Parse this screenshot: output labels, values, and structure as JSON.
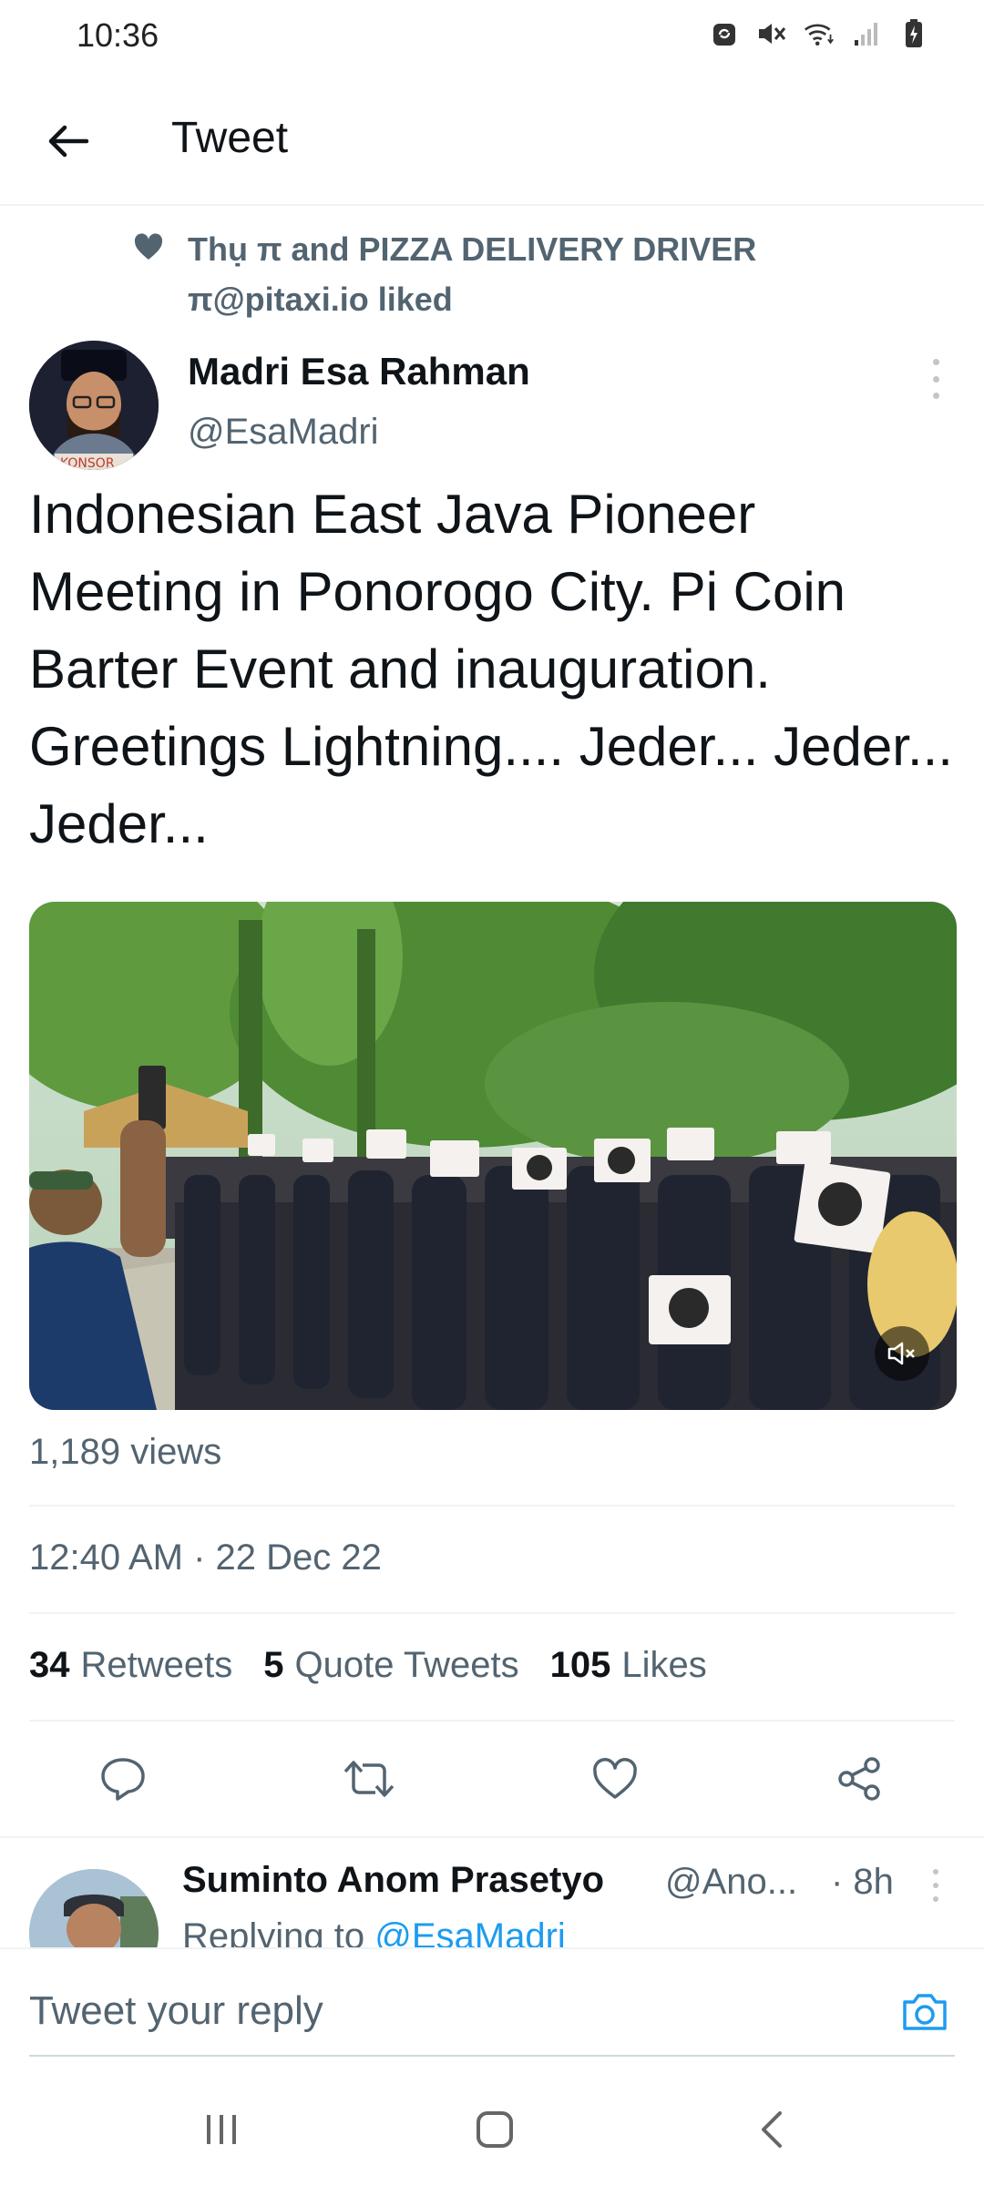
{
  "status_bar": {
    "time": "10:36",
    "icons": [
      "sync-icon",
      "mute-icon",
      "wifi-icon",
      "signal-icon",
      "battery-charging-icon"
    ]
  },
  "header": {
    "back_icon": "arrow-left-icon",
    "title": "Tweet"
  },
  "social_context": {
    "icon": "heart-icon",
    "text": "Thụ π and PIZZA DELIVERY DRIVER π@pitaxi.io liked"
  },
  "tweet": {
    "author_name": "Madri Esa Rahman",
    "author_handle": "@EsaMadri",
    "text": "Indonesian East Java Pioneer Meeting in Ponorogo City. Pi Coin Barter Event and inauguration. Greetings Lightning.... Jeder... Jeder... Jeder...",
    "views": "1,189 views",
    "timestamp": "12:40 AM · 22 Dec 22",
    "stats": {
      "retweets_count": "34",
      "retweets_label": "Retweets",
      "quotes_count": "5",
      "quotes_label": "Quote Tweets",
      "likes_count": "105",
      "likes_label": "Likes"
    }
  },
  "actions": [
    "reply-icon",
    "retweet-icon",
    "like-icon",
    "share-icon"
  ],
  "reply": {
    "author_name": "Suminto Anom Prasetyo",
    "author_handle": "@Ano...",
    "time": "· 8h",
    "replying_prefix": "Replying to",
    "replying_handle": "@EsaMadri"
  },
  "composer": {
    "placeholder": "Tweet your reply",
    "camera_icon": "camera-icon"
  },
  "colors": {
    "accent": "#1d9bf0",
    "secondary_text": "#536471",
    "primary_text": "#0f1419"
  }
}
